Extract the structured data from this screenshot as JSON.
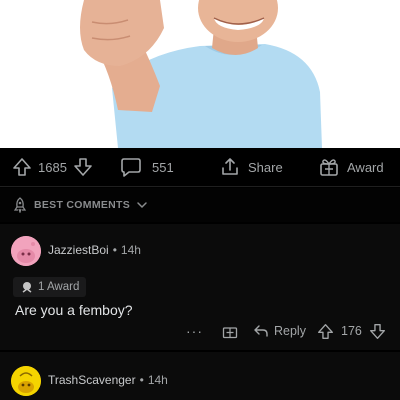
{
  "post_actions": {
    "upvote_count": "1685",
    "comment_count": "551",
    "share_label": "Share",
    "award_label": "Award"
  },
  "sort": {
    "label": "BEST COMMENTS"
  },
  "comments": [
    {
      "username": "JazziestBoi",
      "time": "14h",
      "award_text": "1 Award",
      "body": "Are you a femboy?",
      "more": "···",
      "reply_label": "Reply",
      "score": "176"
    },
    {
      "username": "TrashScavenger",
      "time": "14h"
    }
  ],
  "colors": {
    "background": "#000000",
    "comment_bg": "#0b0b0b",
    "muted_text": "#a3a6a8",
    "avatar1": "#f2a3bd",
    "avatar2": "#f5d400",
    "shirt": "#a8d6f0"
  }
}
